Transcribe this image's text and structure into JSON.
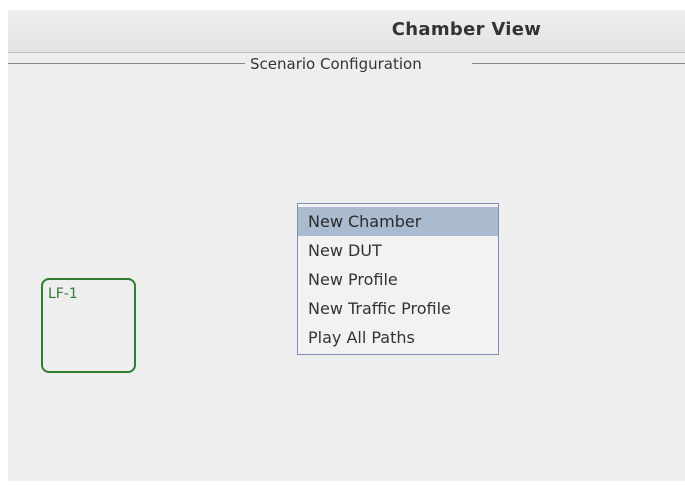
{
  "window": {
    "title": "Chamber View"
  },
  "section": {
    "label": "Scenario Configuration"
  },
  "chambers": [
    {
      "label": "LF-1",
      "border_color": "#2f7d2f"
    }
  ],
  "context_menu": {
    "items": [
      {
        "label": "New Chamber",
        "selected": true
      },
      {
        "label": "New DUT",
        "selected": false
      },
      {
        "label": "New Profile",
        "selected": false
      },
      {
        "label": "New Traffic Profile",
        "selected": false
      },
      {
        "label": "Play All Paths",
        "selected": false
      }
    ],
    "highlight_color": "#aabbd0",
    "border_color": "#7b8fb7"
  }
}
